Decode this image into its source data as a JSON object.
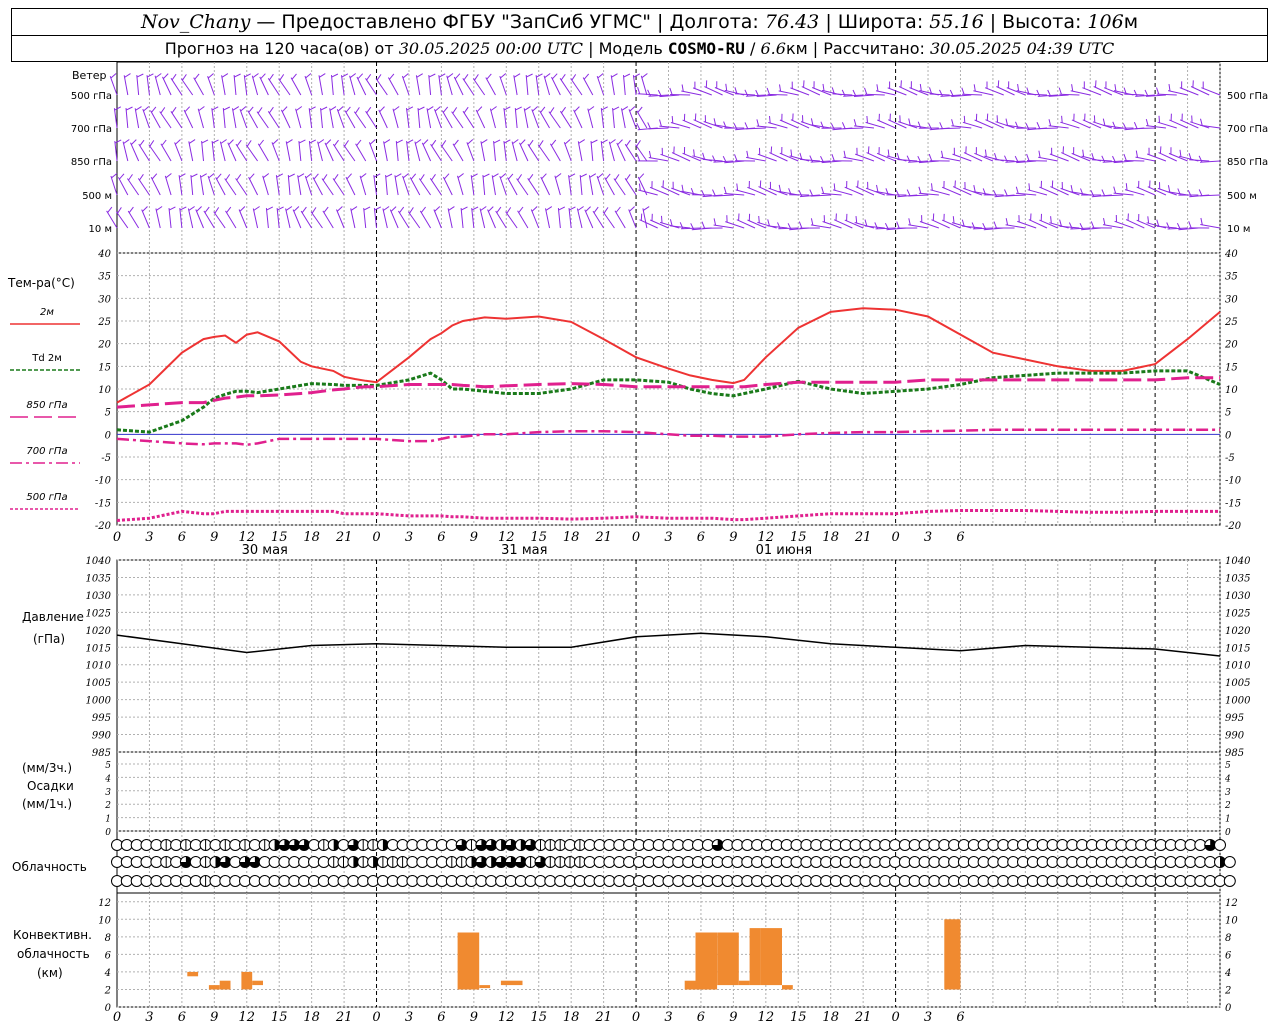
{
  "header": {
    "station": "Nov_Chany",
    "provider": " — Предоставлено ФГБУ \"ЗапСиб УГМС\" | Долгота: ",
    "lon": "76.43",
    "lat_label": " | Широта: ",
    "lat": "55.16",
    "alt_label": " | Высота: ",
    "alt": "106",
    "alt_unit": "м",
    "fc_prefix": "Прогноз на 120 часа(ов) от ",
    "fc_start": "30.05.2025 00:00 UTC",
    "model_label": " | Модель ",
    "model": "COSMO-RU",
    "res_sep": " / ",
    "res": "6.6",
    "res_unit": "км",
    "calc_label": " | Рассчитано: ",
    "calc_time": "30.05.2025 04:39 UTC"
  },
  "colors": {
    "wind": "#8a2be2",
    "t2m": "#ee3333",
    "td2m": "#1a7a1a",
    "t850": "#e0208e",
    "pressure": "#000000",
    "convective": "#f08a30",
    "grid": "#b0b0b0"
  },
  "wind_panel": {
    "title": "Ветер",
    "levels": [
      "500 гПа",
      "700 гПа",
      "850 гПа",
      "500 м",
      "10  м"
    ]
  },
  "temp_panel": {
    "title": "Тем-ра(°C)",
    "legend": [
      {
        "label": "2м",
        "key": "t2m"
      },
      {
        "label": "Td 2м",
        "key": "td2m"
      },
      {
        "label": "850 гПа",
        "key": "t850"
      },
      {
        "label": "700 гПа",
        "key": "t700"
      },
      {
        "label": "500 гПа",
        "key": "t500"
      }
    ]
  },
  "pressure_panel": {
    "title": "Давление",
    "unit": "(гПа)"
  },
  "precip_panel": {
    "line1": "(мм/3ч.)",
    "line2": "Осадки",
    "line3": "(мм/1ч.)"
  },
  "cloud_panel": {
    "title": "Облачность"
  },
  "conv_panel": {
    "line1": "Конвективн.",
    "line2": "облачность",
    "line3": "(км)"
  },
  "day_labels": [
    "30 мая",
    "31 мая",
    "01 июня"
  ],
  "hour_ticks": [
    "0",
    "3",
    "6",
    "9",
    "12",
    "15",
    "18",
    "21",
    "0",
    "3",
    "6",
    "9",
    "12",
    "15",
    "18",
    "21",
    "0",
    "3",
    "6",
    "9",
    "12",
    "15",
    "18",
    "21",
    "0",
    "3",
    "6"
  ],
  "chart_data": [
    {
      "type": "line",
      "name": "temperature",
      "x_hours": [
        0,
        3,
        6,
        8,
        9,
        10,
        11,
        12,
        13,
        15,
        17,
        18,
        20,
        21,
        22,
        23,
        24,
        27,
        29,
        30,
        31,
        32,
        34,
        36,
        39,
        42,
        45,
        48,
        51,
        53,
        55,
        57,
        58,
        60,
        63,
        66,
        69,
        72,
        75,
        78,
        81,
        84,
        87,
        90,
        93,
        96,
        99,
        102
      ],
      "yticks": [
        "40",
        "35",
        "30",
        "25",
        "20",
        "15",
        "10",
        "5",
        "0",
        "-5",
        "-10",
        "-15",
        "-20"
      ],
      "ylim": [
        -20,
        40
      ],
      "series": [
        {
          "name": "2м",
          "values": [
            7,
            11,
            18,
            21,
            21.5,
            21.8,
            20.2,
            22,
            22.5,
            20.5,
            16,
            15,
            14,
            12.7,
            12.2,
            11.8,
            11.5,
            17,
            21,
            22.3,
            24,
            25,
            25.8,
            25.5,
            26,
            24.8,
            21,
            17,
            14.5,
            13,
            12,
            11.3,
            12,
            17,
            23.5,
            27,
            27.8,
            27.5,
            26,
            22,
            18,
            16.5,
            15,
            14,
            14,
            15.5,
            21,
            27
          ]
        },
        {
          "name": "Td 2м",
          "values": [
            1,
            0.5,
            3,
            6,
            8,
            8.8,
            9.5,
            9.5,
            9.2,
            10,
            10.8,
            11.2,
            11,
            10.8,
            10.8,
            10.8,
            10.8,
            12,
            13.5,
            12,
            10,
            10,
            9.5,
            9,
            9,
            10,
            12,
            12,
            11.5,
            10,
            9,
            8.5,
            9,
            10,
            11.7,
            10,
            9,
            9.5,
            10,
            11,
            12.5,
            13,
            13.5,
            13.5,
            13.5,
            14,
            14,
            11
          ]
        },
        {
          "name": "850 гПа",
          "values": [
            6,
            6.5,
            7,
            7,
            7.5,
            8,
            8.2,
            8.5,
            8.5,
            8.7,
            9,
            9.2,
            9.8,
            10,
            10.3,
            10.5,
            10.5,
            11,
            11,
            11,
            11,
            10.8,
            10.5,
            10.7,
            11,
            11.2,
            11,
            10.5,
            10.5,
            10.5,
            10.5,
            10.5,
            10.5,
            11,
            11.5,
            11.5,
            11.5,
            11.5,
            12,
            12,
            12,
            12,
            12,
            12,
            12,
            12,
            12.5,
            12.5
          ]
        },
        {
          "name": "700 гПа",
          "values": [
            -1,
            -1.5,
            -2,
            -2.2,
            -2,
            -2,
            -2,
            -2.3,
            -2,
            -1,
            -1,
            -1,
            -1,
            -1,
            -1,
            -1,
            -1,
            -1.5,
            -1.5,
            -1,
            -0.5,
            -0.5,
            0,
            0,
            0.5,
            0.7,
            0.7,
            0.5,
            0,
            -0.3,
            -0.3,
            -0.5,
            -0.5,
            -0.5,
            0,
            0.3,
            0.5,
            0.5,
            0.7,
            0.8,
            1,
            1,
            1,
            1,
            1,
            1,
            1,
            1
          ]
        },
        {
          "name": "500 гПа",
          "values": [
            -19,
            -18.5,
            -17,
            -17.5,
            -17.5,
            -17,
            -17,
            -17,
            -17,
            -17,
            -17,
            -17,
            -17,
            -17.5,
            -17.5,
            -17.5,
            -17.5,
            -18,
            -18,
            -18,
            -18.2,
            -18.2,
            -18.5,
            -18.5,
            -18.5,
            -18.7,
            -18.5,
            -18.2,
            -18.5,
            -18.5,
            -18.5,
            -18.8,
            -18.8,
            -18.5,
            -18,
            -17.5,
            -17.5,
            -17.5,
            -17,
            -16.8,
            -16.8,
            -16.8,
            -17,
            -17.2,
            -17.2,
            -17,
            -17,
            -17
          ]
        }
      ]
    },
    {
      "type": "line",
      "name": "pressure",
      "x_hours": [
        0,
        6,
        12,
        18,
        24,
        30,
        36,
        42,
        48,
        54,
        60,
        66,
        72,
        78,
        84,
        90,
        96,
        102
      ],
      "yticks": [
        "1040",
        "1035",
        "1030",
        "1025",
        "1020",
        "1015",
        "1010",
        "1005",
        "1000",
        "995",
        "990",
        "985"
      ],
      "ylim": [
        985,
        1040
      ],
      "series": [
        {
          "name": "Давление",
          "values": [
            1018.5,
            1016,
            1013.5,
            1015.5,
            1016,
            1015.5,
            1015,
            1015,
            1018,
            1019,
            1018,
            1016,
            1015,
            1014,
            1015.5,
            1015,
            1014.5,
            1012.5
          ]
        }
      ]
    },
    {
      "type": "bar",
      "name": "precipitation",
      "yticks": [
        "5",
        "4",
        "3",
        "2",
        "1",
        "0"
      ],
      "ylim": [
        0,
        5
      ],
      "values": []
    },
    {
      "type": "bar",
      "name": "convective_cloud",
      "yticks": [
        "12",
        "10",
        "8",
        "6",
        "4",
        "2",
        "0"
      ],
      "ylim": [
        0,
        13
      ],
      "bars": [
        {
          "from": 6.5,
          "to": 7.5,
          "bottom": 3.5,
          "top": 4
        },
        {
          "from": 8.5,
          "to": 9.5,
          "bottom": 2,
          "top": 2.5
        },
        {
          "from": 9.5,
          "to": 10.5,
          "bottom": 2,
          "top": 3
        },
        {
          "from": 11.5,
          "to": 12.5,
          "bottom": 2,
          "top": 4
        },
        {
          "from": 12.5,
          "to": 13.5,
          "bottom": 2.5,
          "top": 3
        },
        {
          "from": 31.5,
          "to": 33.5,
          "bottom": 2,
          "top": 8.5
        },
        {
          "from": 33.5,
          "to": 34.5,
          "bottom": 2.5,
          "top": 2.5
        },
        {
          "from": 35.5,
          "to": 37.5,
          "bottom": 2.5,
          "top": 3
        },
        {
          "from": 52.5,
          "to": 53.5,
          "bottom": 2,
          "top": 3
        },
        {
          "from": 53.5,
          "to": 55.5,
          "bottom": 2,
          "top": 8.5
        },
        {
          "from": 55.5,
          "to": 57.5,
          "bottom": 2.5,
          "top": 8.5
        },
        {
          "from": 57.5,
          "to": 58.5,
          "bottom": 2.5,
          "top": 3
        },
        {
          "from": 58.5,
          "to": 59.5,
          "bottom": 2.5,
          "top": 9
        },
        {
          "from": 59.5,
          "to": 61.5,
          "bottom": 2.5,
          "top": 9
        },
        {
          "from": 61.5,
          "to": 62.5,
          "bottom": 2,
          "top": 2.5
        },
        {
          "from": 76.5,
          "to": 78,
          "bottom": 2,
          "top": 10
        }
      ]
    },
    {
      "type": "table",
      "name": "cloudiness",
      "rows": [
        "fffffqfqfqfqfqfqhtttfqhftqqhffffffftqtththtqqqfqffffffffffffftffffffffffffffffffffffffffffffffffffffffffffffffftf",
        "fffffqftfqhtfttfffffffqqhqhqqqffffqqhthtttqtqqqqffffffffffffffffffffffffffffffffffffffffffffffffffffffffffffffffhf",
        "fffffffffqffffffffffffffffffffffffffffffffffffffffffffffffffffffffffffffffffffffffffffffffffffffffffffffffffffffff"
      ]
    }
  ]
}
